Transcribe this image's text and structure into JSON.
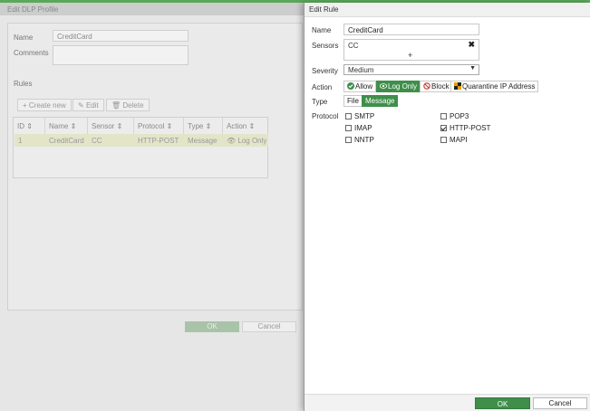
{
  "background_dialog": {
    "title": "Edit DLP Profile",
    "name_label": "Name",
    "name_value": "CreditCard",
    "comments_label": "Comments",
    "rules_label": "Rules",
    "toolbar": {
      "create_new": "Create new",
      "edit": "Edit",
      "delete": "Delete"
    },
    "table": {
      "headers": [
        "ID",
        "Name",
        "Sensor",
        "Protocol",
        "Type",
        "Action"
      ],
      "rows": [
        {
          "id": "1",
          "name": "CreditCard",
          "sensor": "CC",
          "protocol": "HTTP-POST",
          "type": "Message",
          "action": "Log Only"
        }
      ]
    },
    "ok_label": "OK",
    "cancel_label": "Cancel"
  },
  "edit_rule": {
    "title": "Edit Rule",
    "name_label": "Name",
    "name_value": "CreditCard",
    "sensors_label": "Sensors",
    "sensor_value": "CC",
    "remove_symbol": "✖",
    "add_symbol": "+",
    "severity_label": "Severity",
    "severity_value": "Medium",
    "action_label": "Action",
    "actions": {
      "allow": "Allow",
      "log_only": "Log Only",
      "block": "Block",
      "quarantine": "Quarantine IP Address"
    },
    "selected_action": "Log Only",
    "type_label": "Type",
    "types": {
      "file": "File",
      "message": "Message"
    },
    "selected_type": "Message",
    "protocol_label": "Protocol",
    "protocols": {
      "smtp": {
        "label": "SMTP",
        "checked": false
      },
      "pop3": {
        "label": "POP3",
        "checked": false
      },
      "imap": {
        "label": "IMAP",
        "checked": false
      },
      "http_post": {
        "label": "HTTP-POST",
        "checked": true
      },
      "nntp": {
        "label": "NNTP",
        "checked": false
      },
      "mapi": {
        "label": "MAPI",
        "checked": false
      }
    },
    "ok_label": "OK",
    "cancel_label": "Cancel"
  },
  "colors": {
    "accent": "#3f8f4a",
    "topbar": "#5aa85a",
    "selected_row": "#e3e5c8"
  }
}
